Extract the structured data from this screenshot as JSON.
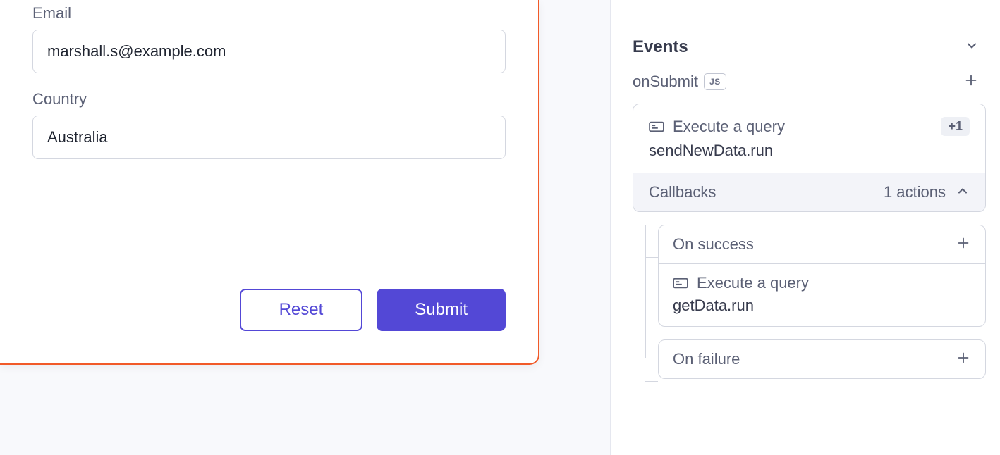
{
  "form": {
    "email_label": "Email",
    "email_value": "marshall.s@example.com",
    "country_label": "Country",
    "country_value": "Australia",
    "reset_label": "Reset",
    "submit_label": "Submit"
  },
  "events": {
    "section_title": "Events",
    "handler_name": "onSubmit",
    "js_badge": "JS",
    "action": {
      "label": "Execute a query",
      "badge": "+1",
      "fn": "sendNewData.run"
    },
    "callbacks": {
      "label": "Callbacks",
      "count_text": "1 actions",
      "on_success": {
        "title": "On success",
        "action_label": "Execute a query",
        "action_fn": "getData.run"
      },
      "on_failure": {
        "title": "On failure"
      }
    }
  },
  "colors": {
    "accent_orange": "#f15a29",
    "accent_purple": "#5348d6",
    "text_muted": "#5b6075",
    "text_dark": "#373b4d",
    "border": "#d4d7e0"
  }
}
